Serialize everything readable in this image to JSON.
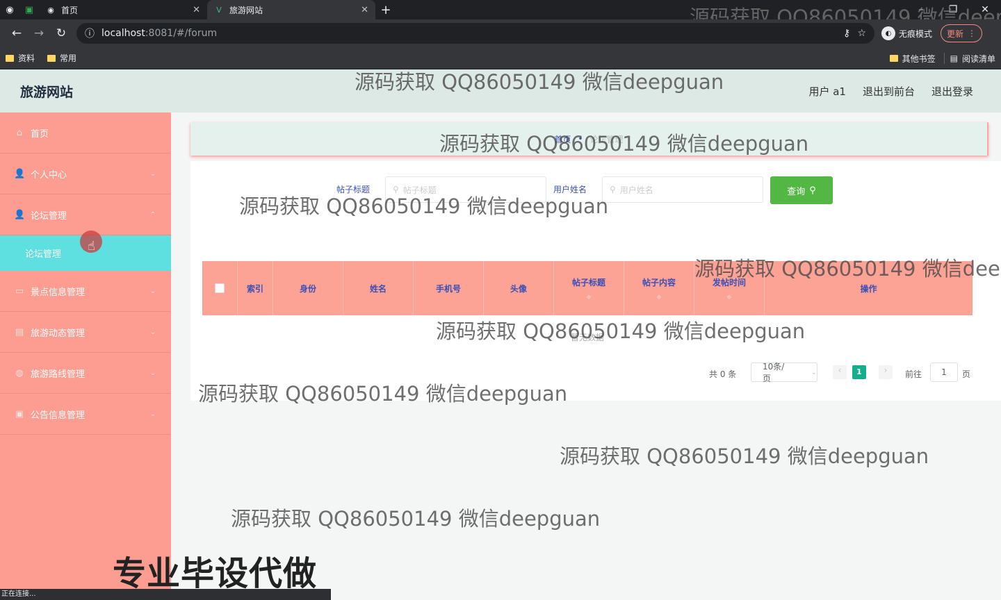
{
  "browser": {
    "tabs": [
      {
        "title": "首页",
        "active": false
      },
      {
        "title": "旅游网站",
        "active": true
      }
    ],
    "url_host": "localhost",
    "url_rest": ":8081/#/forum",
    "incognito_label": "无痕模式",
    "update_label": "更新",
    "bookmarks": [
      "资料",
      "常用"
    ],
    "bookmarks_right": [
      "其他书签",
      "阅读清单"
    ],
    "status_text": "正在连接..."
  },
  "header": {
    "brand": "旅游网站",
    "user": "用户 a1",
    "to_front": "退出到前台",
    "logout": "退出登录"
  },
  "sidebar": {
    "items": [
      {
        "label": "首页",
        "icon": "home-icon"
      },
      {
        "label": "个人中心",
        "icon": "user-icon"
      },
      {
        "label": "论坛管理",
        "icon": "user-icon"
      },
      {
        "label": "论坛管理",
        "sub": true
      },
      {
        "label": "景点信息管理",
        "icon": "list-icon"
      },
      {
        "label": "旅游动态管理",
        "icon": "document-icon"
      },
      {
        "label": "旅游路线管理",
        "icon": "globe-icon"
      },
      {
        "label": "公告信息管理",
        "icon": "clipboard-icon"
      }
    ]
  },
  "breadcrumb": {
    "home": "首页",
    "current": "论坛管理"
  },
  "search": {
    "title_label": "帖子标题",
    "title_placeholder": "帖子标题",
    "user_label": "用户姓名",
    "user_placeholder": "用户姓名",
    "query_button": "查询"
  },
  "table": {
    "headers": [
      "索引",
      "身份",
      "姓名",
      "手机号",
      "头像",
      "帖子标题",
      "帖子内容",
      "发帖时间",
      "操作"
    ],
    "empty_text": "暂无数据"
  },
  "pagination": {
    "total": "共 0 条",
    "page_size": "10条/页",
    "current_page": "1",
    "goto_label": "前往",
    "goto_value": "1",
    "page_suffix": "页"
  },
  "watermark": "源码获取 QQ86050149 微信deepguan",
  "promo": "专业毕设代做",
  "colors": {
    "sidebar": "#fd9d91",
    "sidebar_active": "#5ee0e0",
    "header": "#dde9e4",
    "table_head": "#fca396",
    "query_button": "#52b843",
    "accent_text": "#3c4fb5"
  }
}
